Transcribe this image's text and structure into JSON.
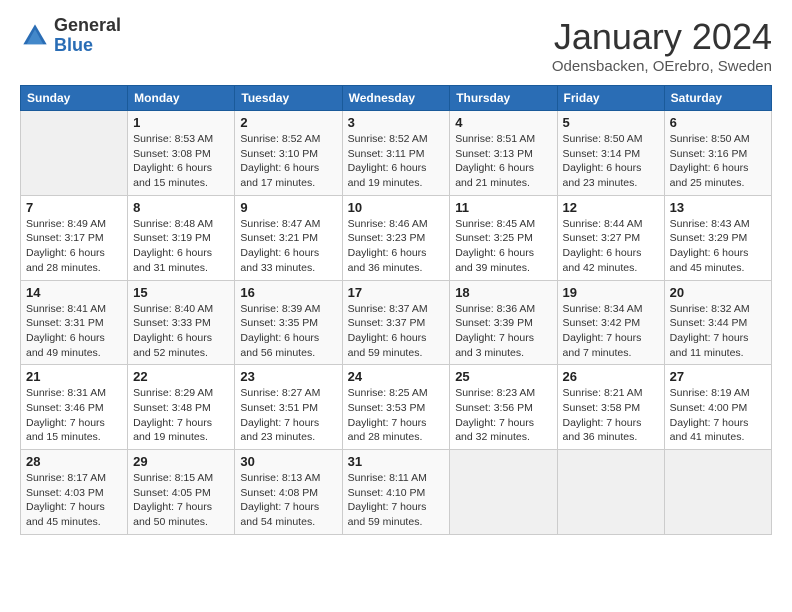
{
  "header": {
    "logo_general": "General",
    "logo_blue": "Blue",
    "month_title": "January 2024",
    "subtitle": "Odensbacken, OErebro, Sweden"
  },
  "weekdays": [
    "Sunday",
    "Monday",
    "Tuesday",
    "Wednesday",
    "Thursday",
    "Friday",
    "Saturday"
  ],
  "weeks": [
    [
      {
        "day": "",
        "sunrise": "",
        "sunset": "",
        "daylight": ""
      },
      {
        "day": "1",
        "sunrise": "Sunrise: 8:53 AM",
        "sunset": "Sunset: 3:08 PM",
        "daylight": "Daylight: 6 hours and 15 minutes."
      },
      {
        "day": "2",
        "sunrise": "Sunrise: 8:52 AM",
        "sunset": "Sunset: 3:10 PM",
        "daylight": "Daylight: 6 hours and 17 minutes."
      },
      {
        "day": "3",
        "sunrise": "Sunrise: 8:52 AM",
        "sunset": "Sunset: 3:11 PM",
        "daylight": "Daylight: 6 hours and 19 minutes."
      },
      {
        "day": "4",
        "sunrise": "Sunrise: 8:51 AM",
        "sunset": "Sunset: 3:13 PM",
        "daylight": "Daylight: 6 hours and 21 minutes."
      },
      {
        "day": "5",
        "sunrise": "Sunrise: 8:50 AM",
        "sunset": "Sunset: 3:14 PM",
        "daylight": "Daylight: 6 hours and 23 minutes."
      },
      {
        "day": "6",
        "sunrise": "Sunrise: 8:50 AM",
        "sunset": "Sunset: 3:16 PM",
        "daylight": "Daylight: 6 hours and 25 minutes."
      }
    ],
    [
      {
        "day": "7",
        "sunrise": "Sunrise: 8:49 AM",
        "sunset": "Sunset: 3:17 PM",
        "daylight": "Daylight: 6 hours and 28 minutes."
      },
      {
        "day": "8",
        "sunrise": "Sunrise: 8:48 AM",
        "sunset": "Sunset: 3:19 PM",
        "daylight": "Daylight: 6 hours and 31 minutes."
      },
      {
        "day": "9",
        "sunrise": "Sunrise: 8:47 AM",
        "sunset": "Sunset: 3:21 PM",
        "daylight": "Daylight: 6 hours and 33 minutes."
      },
      {
        "day": "10",
        "sunrise": "Sunrise: 8:46 AM",
        "sunset": "Sunset: 3:23 PM",
        "daylight": "Daylight: 6 hours and 36 minutes."
      },
      {
        "day": "11",
        "sunrise": "Sunrise: 8:45 AM",
        "sunset": "Sunset: 3:25 PM",
        "daylight": "Daylight: 6 hours and 39 minutes."
      },
      {
        "day": "12",
        "sunrise": "Sunrise: 8:44 AM",
        "sunset": "Sunset: 3:27 PM",
        "daylight": "Daylight: 6 hours and 42 minutes."
      },
      {
        "day": "13",
        "sunrise": "Sunrise: 8:43 AM",
        "sunset": "Sunset: 3:29 PM",
        "daylight": "Daylight: 6 hours and 45 minutes."
      }
    ],
    [
      {
        "day": "14",
        "sunrise": "Sunrise: 8:41 AM",
        "sunset": "Sunset: 3:31 PM",
        "daylight": "Daylight: 6 hours and 49 minutes."
      },
      {
        "day": "15",
        "sunrise": "Sunrise: 8:40 AM",
        "sunset": "Sunset: 3:33 PM",
        "daylight": "Daylight: 6 hours and 52 minutes."
      },
      {
        "day": "16",
        "sunrise": "Sunrise: 8:39 AM",
        "sunset": "Sunset: 3:35 PM",
        "daylight": "Daylight: 6 hours and 56 minutes."
      },
      {
        "day": "17",
        "sunrise": "Sunrise: 8:37 AM",
        "sunset": "Sunset: 3:37 PM",
        "daylight": "Daylight: 6 hours and 59 minutes."
      },
      {
        "day": "18",
        "sunrise": "Sunrise: 8:36 AM",
        "sunset": "Sunset: 3:39 PM",
        "daylight": "Daylight: 7 hours and 3 minutes."
      },
      {
        "day": "19",
        "sunrise": "Sunrise: 8:34 AM",
        "sunset": "Sunset: 3:42 PM",
        "daylight": "Daylight: 7 hours and 7 minutes."
      },
      {
        "day": "20",
        "sunrise": "Sunrise: 8:32 AM",
        "sunset": "Sunset: 3:44 PM",
        "daylight": "Daylight: 7 hours and 11 minutes."
      }
    ],
    [
      {
        "day": "21",
        "sunrise": "Sunrise: 8:31 AM",
        "sunset": "Sunset: 3:46 PM",
        "daylight": "Daylight: 7 hours and 15 minutes."
      },
      {
        "day": "22",
        "sunrise": "Sunrise: 8:29 AM",
        "sunset": "Sunset: 3:48 PM",
        "daylight": "Daylight: 7 hours and 19 minutes."
      },
      {
        "day": "23",
        "sunrise": "Sunrise: 8:27 AM",
        "sunset": "Sunset: 3:51 PM",
        "daylight": "Daylight: 7 hours and 23 minutes."
      },
      {
        "day": "24",
        "sunrise": "Sunrise: 8:25 AM",
        "sunset": "Sunset: 3:53 PM",
        "daylight": "Daylight: 7 hours and 28 minutes."
      },
      {
        "day": "25",
        "sunrise": "Sunrise: 8:23 AM",
        "sunset": "Sunset: 3:56 PM",
        "daylight": "Daylight: 7 hours and 32 minutes."
      },
      {
        "day": "26",
        "sunrise": "Sunrise: 8:21 AM",
        "sunset": "Sunset: 3:58 PM",
        "daylight": "Daylight: 7 hours and 36 minutes."
      },
      {
        "day": "27",
        "sunrise": "Sunrise: 8:19 AM",
        "sunset": "Sunset: 4:00 PM",
        "daylight": "Daylight: 7 hours and 41 minutes."
      }
    ],
    [
      {
        "day": "28",
        "sunrise": "Sunrise: 8:17 AM",
        "sunset": "Sunset: 4:03 PM",
        "daylight": "Daylight: 7 hours and 45 minutes."
      },
      {
        "day": "29",
        "sunrise": "Sunrise: 8:15 AM",
        "sunset": "Sunset: 4:05 PM",
        "daylight": "Daylight: 7 hours and 50 minutes."
      },
      {
        "day": "30",
        "sunrise": "Sunrise: 8:13 AM",
        "sunset": "Sunset: 4:08 PM",
        "daylight": "Daylight: 7 hours and 54 minutes."
      },
      {
        "day": "31",
        "sunrise": "Sunrise: 8:11 AM",
        "sunset": "Sunset: 4:10 PM",
        "daylight": "Daylight: 7 hours and 59 minutes."
      },
      {
        "day": "",
        "sunrise": "",
        "sunset": "",
        "daylight": ""
      },
      {
        "day": "",
        "sunrise": "",
        "sunset": "",
        "daylight": ""
      },
      {
        "day": "",
        "sunrise": "",
        "sunset": "",
        "daylight": ""
      }
    ]
  ]
}
